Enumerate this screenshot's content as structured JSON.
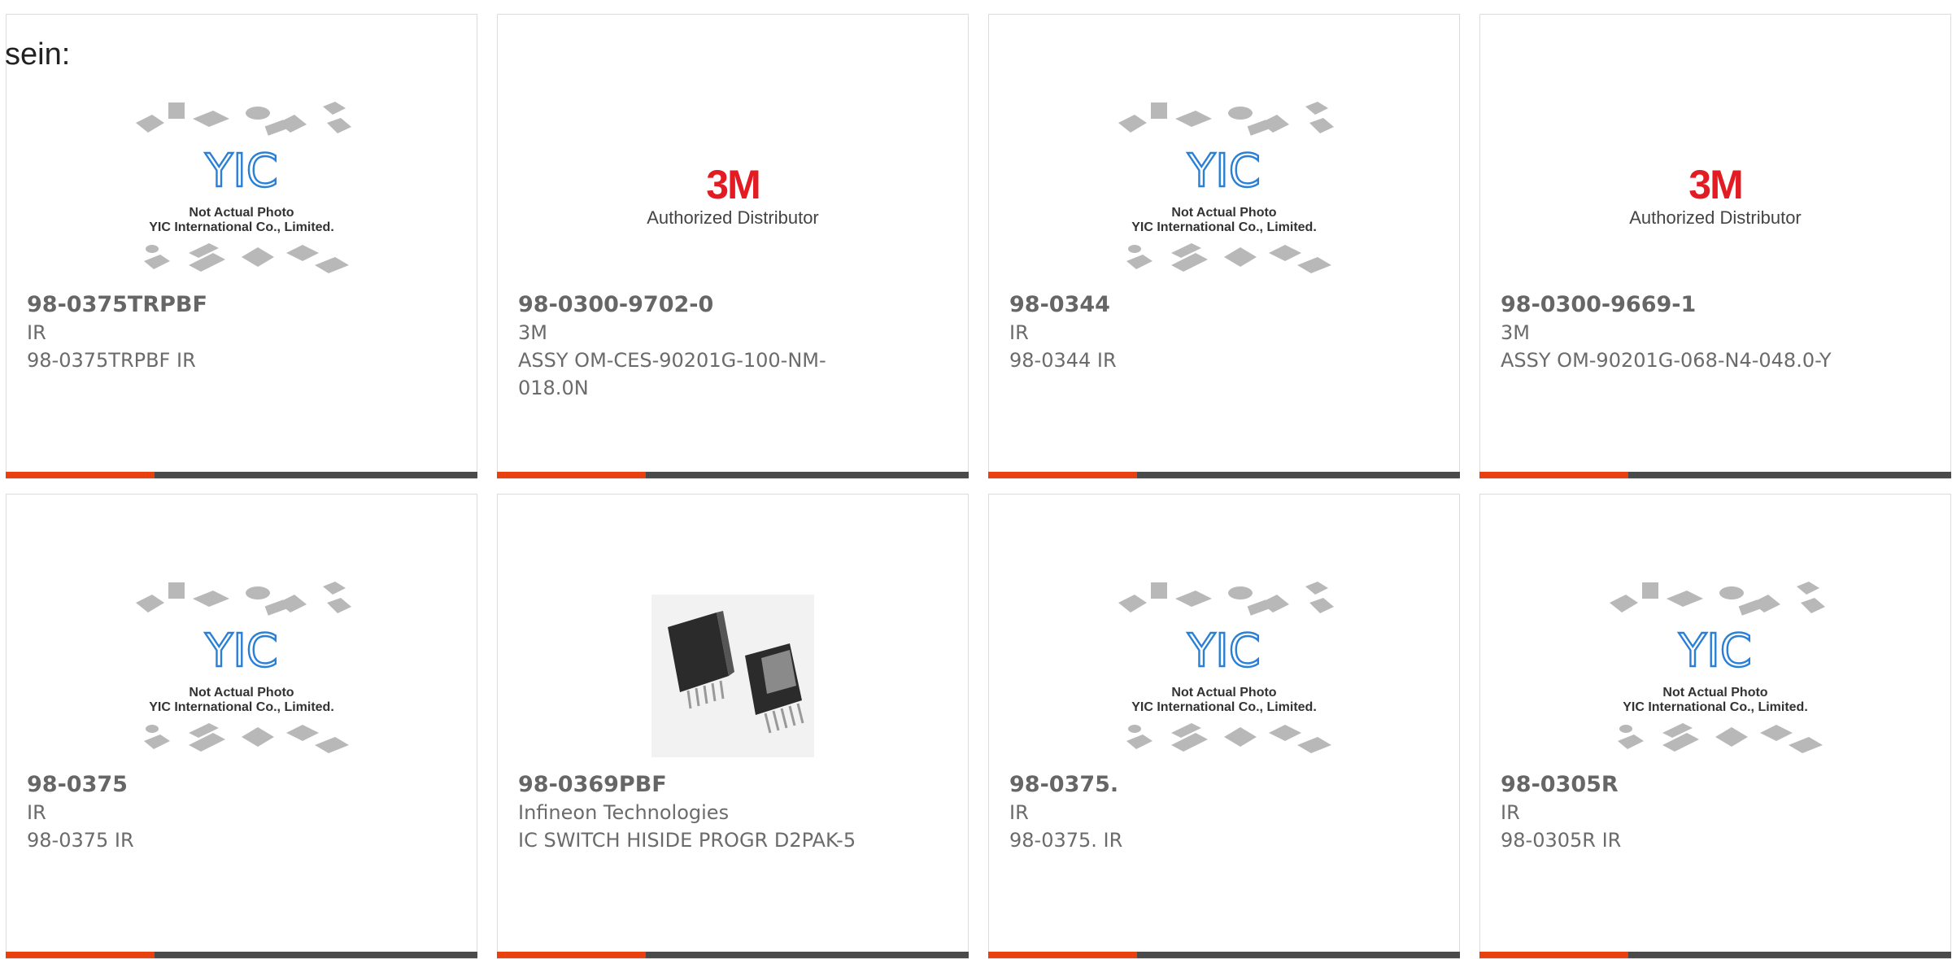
{
  "intro_text": "sein:",
  "placeholder": {
    "line1": "Not Actual Photo",
    "line2": "YIC International Co., Limited.",
    "logo": "YIC"
  },
  "brand_badge": {
    "logo": "3M",
    "caption": "Authorized Distributor"
  },
  "colors": {
    "accent": "#e8400f",
    "bar": "#4a4a4a",
    "border": "#dcdcdc",
    "text": "#666666",
    "yic_blue": "#2a7fd6",
    "brand_red": "#e31b23"
  },
  "products": [
    {
      "part_number": "98-0375TRPBF",
      "manufacturer": "IR",
      "description": "98-0375TRPBF IR",
      "image": "placeholder"
    },
    {
      "part_number": "98-0300-9702-0",
      "manufacturer": "3M",
      "description": "ASSY OM-CES-90201G-100-NM-018.0N",
      "image": "brand"
    },
    {
      "part_number": "98-0344",
      "manufacturer": "IR",
      "description": "98-0344 IR",
      "image": "placeholder"
    },
    {
      "part_number": "98-0300-9669-1",
      "manufacturer": "3M",
      "description": "ASSY OM-90201G-068-N4-048.0-Y",
      "image": "brand"
    },
    {
      "part_number": "98-0375",
      "manufacturer": "IR",
      "description": "98-0375 IR",
      "image": "placeholder"
    },
    {
      "part_number": "98-0369PBF",
      "manufacturer": "Infineon Technologies",
      "description": "IC SWITCH HISIDE PROGR D2PAK-5",
      "image": "photo"
    },
    {
      "part_number": "98-0375.",
      "manufacturer": "IR",
      "description": "98-0375. IR",
      "image": "placeholder"
    },
    {
      "part_number": "98-0305R",
      "manufacturer": "IR",
      "description": "98-0305R IR",
      "image": "placeholder"
    }
  ]
}
